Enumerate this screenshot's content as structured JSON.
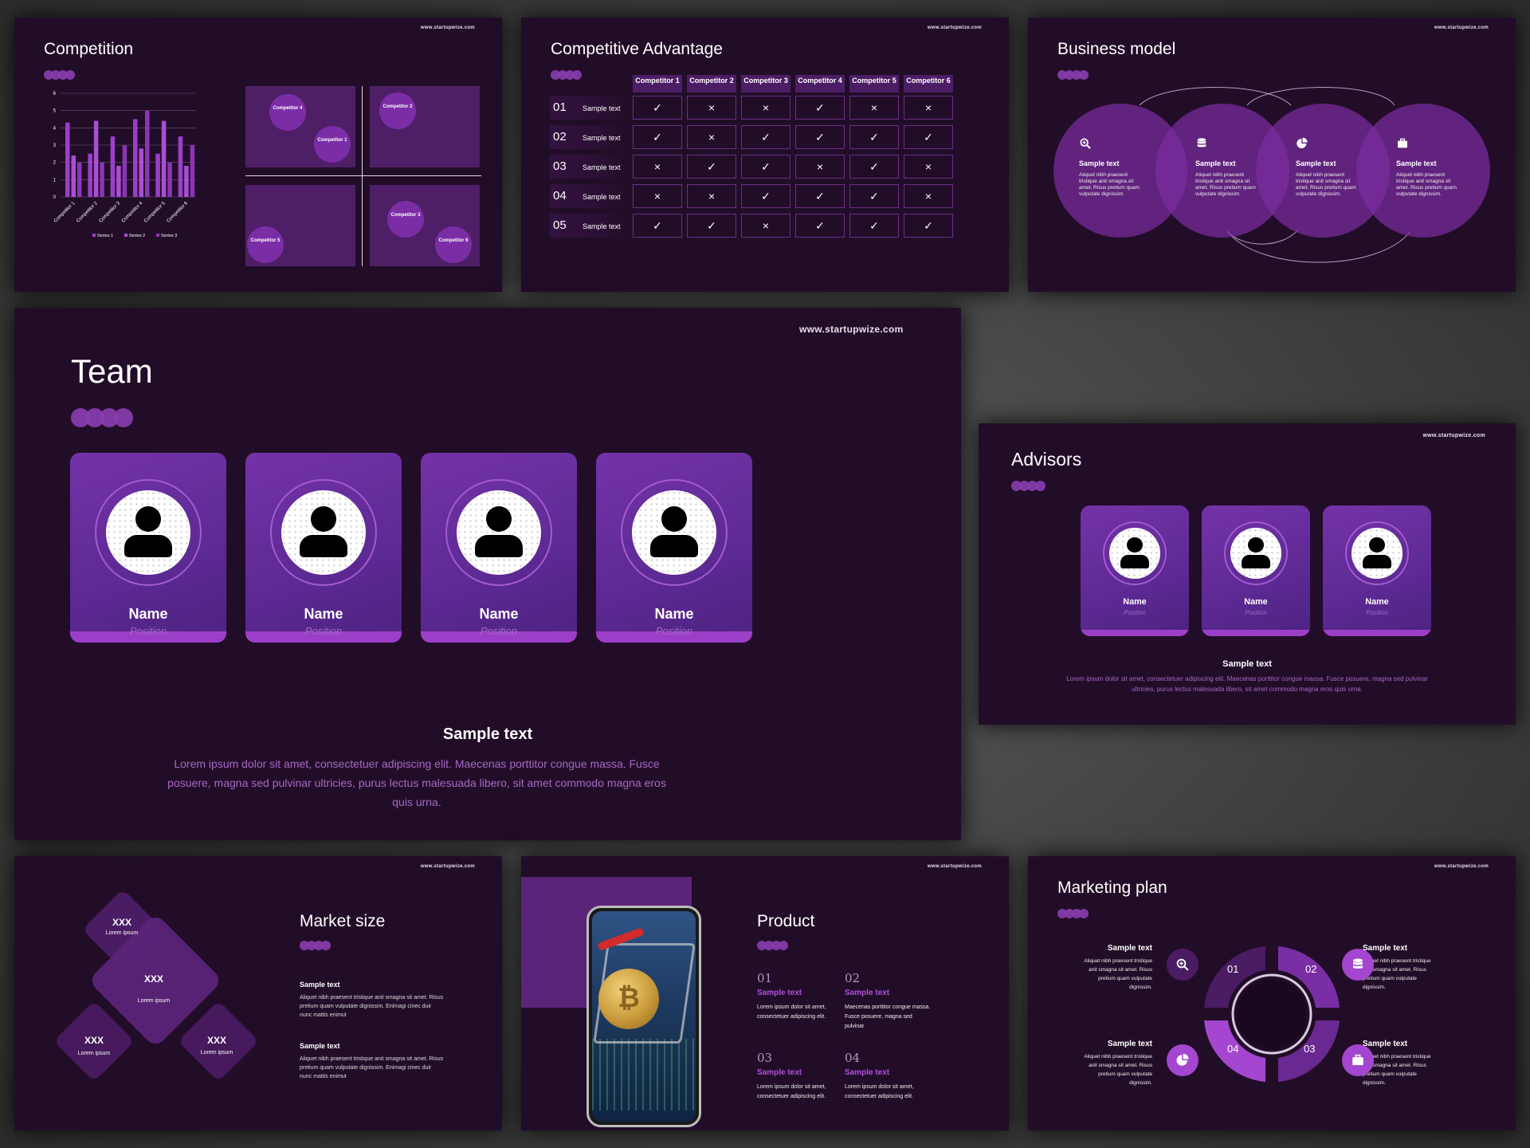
{
  "url": "www.startupwize.com",
  "competition": {
    "title": "Competition",
    "chart_data": {
      "type": "bar",
      "categories": [
        "Competitor 1",
        "Competitor 2",
        "Competitor 3",
        "Competitor 4",
        "Competitor 5",
        "Competitor 6"
      ],
      "series": [
        {
          "name": "Series 1",
          "values": [
            4.3,
            2.5,
            3.5,
            4.5,
            2.5,
            3.5
          ],
          "color": "#9b3fc9"
        },
        {
          "name": "Series 2",
          "values": [
            2.4,
            4.4,
            1.8,
            2.8,
            4.4,
            1.8
          ],
          "color": "#a94fd4"
        },
        {
          "name": "Series 3",
          "values": [
            2.0,
            2.0,
            3.0,
            5.0,
            2.0,
            3.0
          ],
          "color": "#8b35b5"
        }
      ],
      "yticks": [
        "0",
        "1",
        "2",
        "3",
        "4",
        "5",
        "6"
      ],
      "ylim": [
        0,
        6
      ],
      "legend": "bottom"
    },
    "matrix": [
      {
        "label": "Competitor 4"
      },
      {
        "label": "Competitor 1"
      },
      {
        "label": "Competitor 2"
      },
      {
        "label": "Competitor 3"
      },
      {
        "label": "Competitor 5"
      },
      {
        "label": "Competitor 6"
      }
    ]
  },
  "advantage": {
    "title": "Competitive Advantage",
    "columns": [
      "Competitor 1",
      "Competitor 2",
      "Competitor 3",
      "Competitor 4",
      "Competitor 5",
      "Competitor 6"
    ],
    "rows": [
      {
        "num": "01",
        "label": "Sample text",
        "cells": [
          "✓",
          "×",
          "×",
          "✓",
          "×",
          "×"
        ]
      },
      {
        "num": "02",
        "label": "Sample text",
        "cells": [
          "✓",
          "×",
          "✓",
          "✓",
          "✓",
          "✓"
        ]
      },
      {
        "num": "03",
        "label": "Sample text",
        "cells": [
          "×",
          "✓",
          "✓",
          "×",
          "✓",
          "×"
        ]
      },
      {
        "num": "04",
        "label": "Sample text",
        "cells": [
          "×",
          "×",
          "✓",
          "✓",
          "✓",
          "×"
        ]
      },
      {
        "num": "05",
        "label": "Sample text",
        "cells": [
          "✓",
          "✓",
          "×",
          "✓",
          "✓",
          "✓"
        ]
      }
    ]
  },
  "business": {
    "title": "Business model",
    "items": [
      {
        "icon": "search-plus-icon",
        "title": "Sample text",
        "text": "Aliquet nibh praesent tristique anit smagna sit amet. Risus pretium quam vulputate dignissim."
      },
      {
        "icon": "database-icon",
        "title": "Sample text",
        "text": "Aliquet nibh praesent tristique anit smagna sit amet. Risus pretium quam vulputate dignissim."
      },
      {
        "icon": "pie-chart-icon",
        "title": "Sample text",
        "text": "Aliquet nibh praesent tristique anit smagna sit amet. Risus pretium quam vulputate dignissim."
      },
      {
        "icon": "briefcase-icon",
        "title": "Sample text",
        "text": "Aliquet nibh praesent tristique anit smagna sit amet. Risus pretium quam vulputate dignissim."
      }
    ]
  },
  "team": {
    "title": "Team",
    "members": [
      {
        "name": "Name",
        "position": "Position"
      },
      {
        "name": "Name",
        "position": "Position"
      },
      {
        "name": "Name",
        "position": "Position"
      },
      {
        "name": "Name",
        "position": "Position"
      }
    ],
    "subtitle": "Sample text",
    "body": "Lorem ipsum dolor sit amet, consectetuer adipiscing elit. Maecenas porttitor congue massa. Fusce posuere, magna sed pulvinar ultricies, purus lectus malesuada libero, sit amet commodo magna eros quis urna."
  },
  "advisors": {
    "title": "Advisors",
    "members": [
      {
        "name": "Name",
        "position": "Position"
      },
      {
        "name": "Name",
        "position": "Position"
      },
      {
        "name": "Name",
        "position": "Position"
      }
    ],
    "subtitle": "Sample text",
    "body": "Lorem ipsum dolor sit amet, consectetuer adipiscing elit. Maecenas porttitor congue massa. Fusce posuere, magna sed pulvinar ultricies, purus lectus malesuada libero, sit amet commodo magna eros quis urna."
  },
  "market": {
    "title": "Market size",
    "diamonds": [
      {
        "value": "XXX",
        "label": "Lorem ipsum"
      },
      {
        "value": "XXX",
        "label": "Lorem ipsum"
      },
      {
        "value": "XXX",
        "label": "Lorem ipsum"
      },
      {
        "value": "XXX",
        "label": "Lorem ipsum"
      }
    ],
    "blocks": [
      {
        "title": "Sample text",
        "text": "Aliquet nibh praesent tristique anit smagna sit amet. Risus pretium quam vulputate dignissim. Enimagi cinec duir nunc mattis enimut"
      },
      {
        "title": "Sample text",
        "text": "Aliquet nibh praesent tristique anit smagna sit amet. Risus pretium quam vulputate dignissim. Enimagi cinec duir nunc mattis enimut"
      }
    ]
  },
  "product": {
    "title": "Product",
    "items": [
      {
        "num": "01",
        "title": "Sample text",
        "text": "Lorem ipsum dolor sit amet, consectetuer adipiscing elit."
      },
      {
        "num": "02",
        "title": "Sample text",
        "text": "Maecenas porttitor congue massa. Fusce posuere, magna sed pulvinar"
      },
      {
        "num": "03",
        "title": "Sample text",
        "text": "Lorem ipsum dolor sit amet, consectetuer adipiscing elit."
      },
      {
        "num": "04",
        "title": "Sample text",
        "text": "Lorem ipsum dolor sit amet, consectetuer adipiscing elit."
      }
    ]
  },
  "marketing": {
    "title": "Marketing plan",
    "steps": [
      "01",
      "02",
      "03",
      "04"
    ],
    "items": [
      {
        "title": "Sample text",
        "text": "Aliquet nibh praesent tristique anit smagna sit amet. Risus pretium quam vulputate dignissim.",
        "icon": "search-plus-icon"
      },
      {
        "title": "Sample text",
        "text": "Aliquet nibh praesent tristique anit smagna sit amet. Risus pretium quam vulputate dignissim.",
        "icon": "database-icon"
      },
      {
        "title": "Sample text",
        "text": "Aliquet nibh praesent tristique anit smagna sit amet. Risus pretium quam vulputate dignissim.",
        "icon": "pie-chart-icon"
      },
      {
        "title": "Sample text",
        "text": "Aliquet nibh praesent tristique anit smagna sit amet. Risus pretium quam vulputate dignissim.",
        "icon": "briefcase-icon"
      }
    ]
  }
}
